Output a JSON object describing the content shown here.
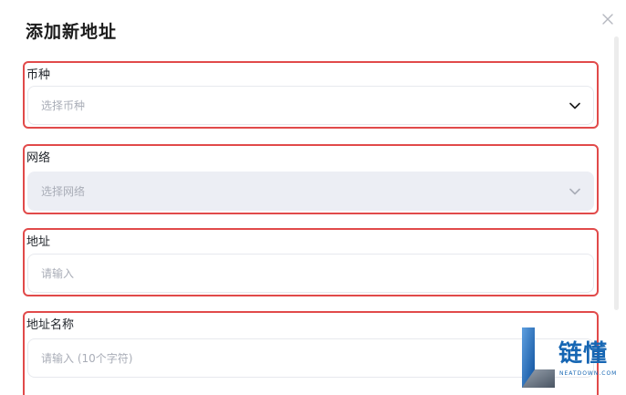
{
  "dialog": {
    "title": "添加新地址",
    "close_symbol": "×"
  },
  "fields": {
    "coin": {
      "label": "币种",
      "placeholder": "选择币种",
      "icon": "chevron-down-icon",
      "disabled": false
    },
    "network": {
      "label": "网络",
      "placeholder": "选择网络",
      "icon": "chevron-down-icon",
      "disabled": true
    },
    "address": {
      "label": "地址",
      "placeholder": "请输入"
    },
    "address_name": {
      "label": "地址名称",
      "placeholder": "请输入 (10个字符)"
    }
  },
  "watermark": {
    "brand_name": "链懂",
    "brand_url": "NEATDOWN.COM"
  },
  "colors": {
    "highlight": "#e14a4a",
    "disabled_bg": "#eceef4",
    "placeholder": "#a9adb7",
    "brand": "#1666b3"
  }
}
